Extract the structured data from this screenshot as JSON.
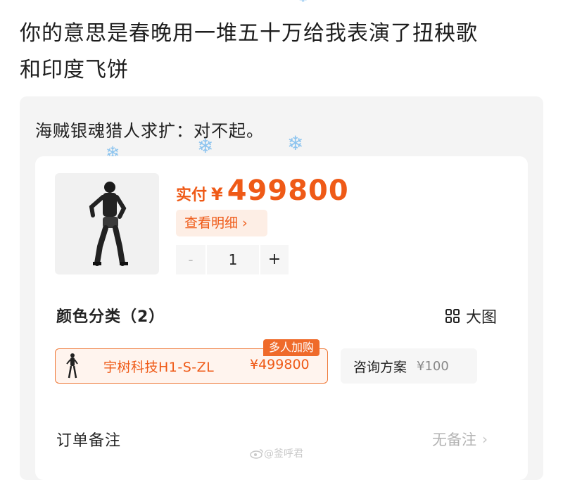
{
  "post": {
    "line1": "你的意思是春晚用一堆五十万给我表演了扭秧歌",
    "line2": "和印度飞饼"
  },
  "card": {
    "caption": "海贼银魂猎人求扩：对不起。"
  },
  "order": {
    "pay_label": "实付",
    "currency": "¥",
    "amount": "499800",
    "detail_button": "查看明细 ›",
    "stepper": {
      "minus": "-",
      "quantity": "1",
      "plus": "+"
    },
    "color_section": "颜色分类（2）",
    "big_view": "大图",
    "variants": [
      {
        "name": "宇树科技H1-S-ZL",
        "price": "¥499800",
        "badge": "多人加购",
        "selected": true
      },
      {
        "name": "咨询方案",
        "price": "¥100",
        "selected": false
      }
    ],
    "remark_label": "订单备注",
    "remark_value": "无备注",
    "remark_arrow": "›"
  },
  "watermark": "@釜呼君",
  "colors": {
    "accent": "#ef5a17",
    "snow": "#8cc4ef"
  },
  "icons": [
    "snowflake-icon",
    "grid-icon",
    "chevron-right-icon",
    "weibo-icon"
  ]
}
